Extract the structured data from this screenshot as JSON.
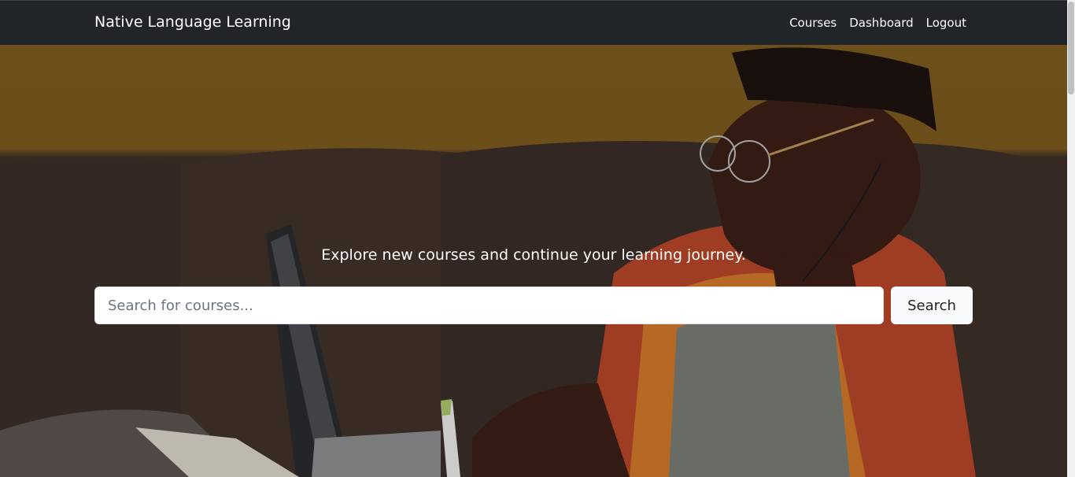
{
  "nav": {
    "brand": "Native Language Learning",
    "links": [
      "Courses",
      "Dashboard",
      "Logout"
    ]
  },
  "hero": {
    "tagline": "Explore new courses and continue your learning journey.",
    "search_placeholder": "Search for courses...",
    "search_button": "Search"
  },
  "colors": {
    "navbar": "#212529",
    "hero_wall": "#7b5a1e",
    "sofa": "#3e2f27",
    "button": "#f8f9fa"
  }
}
